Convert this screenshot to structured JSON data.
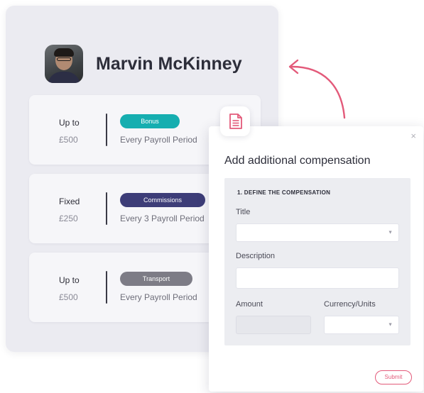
{
  "profile": {
    "name": "Marvin McKinney"
  },
  "compensations": [
    {
      "type": "Up to",
      "amount": "£500",
      "badge": "Bonus",
      "badge_color": "#16aeb0",
      "period": "Every Payroll Period"
    },
    {
      "type": "Fixed",
      "amount": "£250",
      "badge": "Commissions",
      "badge_color": "#3d3d78",
      "period": "Every 3 Payroll Period"
    },
    {
      "type": "Up to",
      "amount": "£500",
      "badge": "Transport",
      "badge_color": "#7d7c86",
      "period": "Every Payroll Period"
    }
  ],
  "modal": {
    "close": "×",
    "title": "Add additional compensation",
    "section_title": "1. DEFINE THE COMPENSATION",
    "title_label": "Title",
    "description_label": "Description",
    "amount_label": "Amount",
    "currency_label": "Currency/Units",
    "submit": "Submit"
  },
  "icons": {
    "doc": "document-icon",
    "arrow": "curved-arrow-icon",
    "caret": "chevron-down-icon"
  },
  "colors": {
    "accent": "#e35a7a",
    "bonus": "#16aeb0",
    "commissions": "#3d3d78",
    "transport": "#7d7c86"
  }
}
